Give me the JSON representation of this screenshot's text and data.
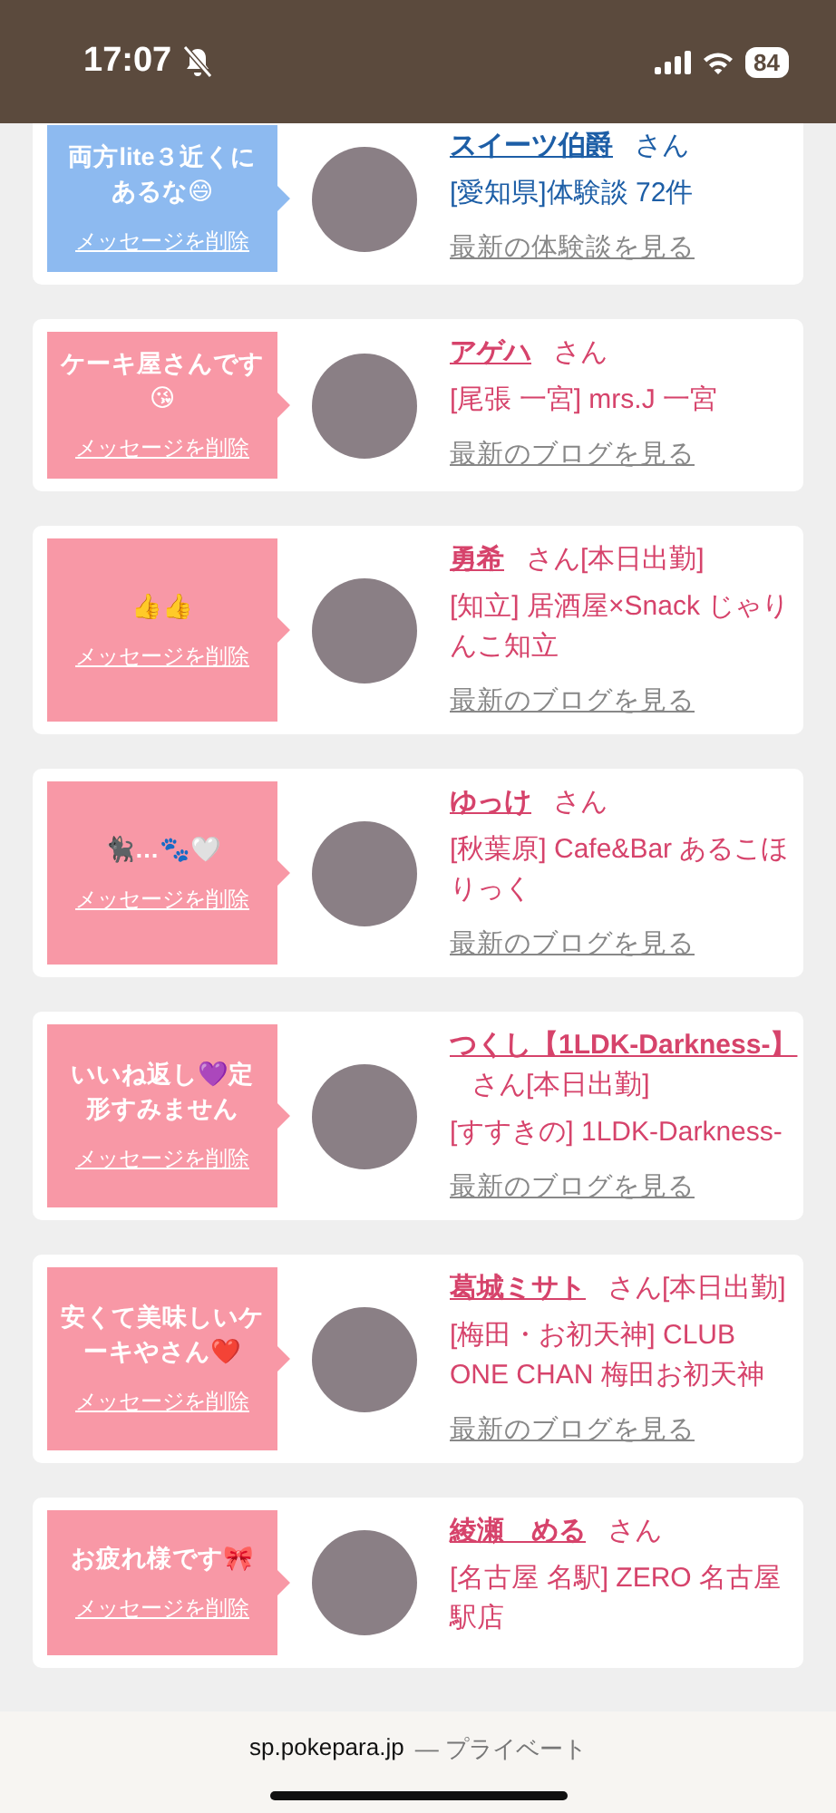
{
  "status_bar": {
    "time": "17:07",
    "battery": "84"
  },
  "posts": [
    {
      "kind": "review",
      "message": "両方lite３近くにあるな😄",
      "delete_link": "メッセージを削除",
      "name": "スイーツ伯爵",
      "honorific": "さん",
      "info": "[愛知県]体験談 72件",
      "link": "最新の体験談を見る"
    },
    {
      "kind": "blog",
      "message": "ケーキ屋さんです😘",
      "delete_link": "メッセージを削除",
      "name": "アゲハ",
      "honorific": "さん",
      "info": "[尾張 一宮] mrs.J 一宮",
      "link": "最新のブログを見る"
    },
    {
      "kind": "blog",
      "message": "👍👍",
      "delete_link": "メッセージを削除",
      "name": "勇希",
      "honorific": "さん",
      "badge": "[本日出勤]",
      "info": "[知立] 居酒屋×Snack じゃりんこ知立",
      "link": "最新のブログを見る"
    },
    {
      "kind": "blog",
      "message": "🐈‍⬛…🐾🤍",
      "delete_link": "メッセージを削除",
      "name": "ゆっけ",
      "honorific": "さん",
      "info": "[秋葉原] Cafe&Bar あるこほりっく",
      "link": "最新のブログを見る"
    },
    {
      "kind": "blog",
      "message": "いいね返し💜定形すみません",
      "delete_link": "メッセージを削除",
      "name": "つくし【1LDK-Darkness-】",
      "honorific": "さん",
      "badge": "[本日出勤]",
      "info": "[すすきの] 1LDK-Darkness-",
      "link": "最新のブログを見る"
    },
    {
      "kind": "blog",
      "message": "安くて美味しいケーキやさん❤️",
      "delete_link": "メッセージを削除",
      "name": "葛城ミサト",
      "honorific": "さん",
      "badge": "[本日出勤]",
      "info": "[梅田・お初天神] CLUB ONE CHAN 梅田お初天神",
      "link": "最新のブログを見る"
    },
    {
      "kind": "blog",
      "message": "お疲れ様です🎀",
      "delete_link": "メッセージを削除",
      "name": "綾瀬　める",
      "honorific": "さん",
      "info": "[名古屋 名駅] ZERO 名古屋駅店"
    }
  ],
  "browser_bar": {
    "domain": "sp.pokepara.jp",
    "label": "— プライベート"
  }
}
